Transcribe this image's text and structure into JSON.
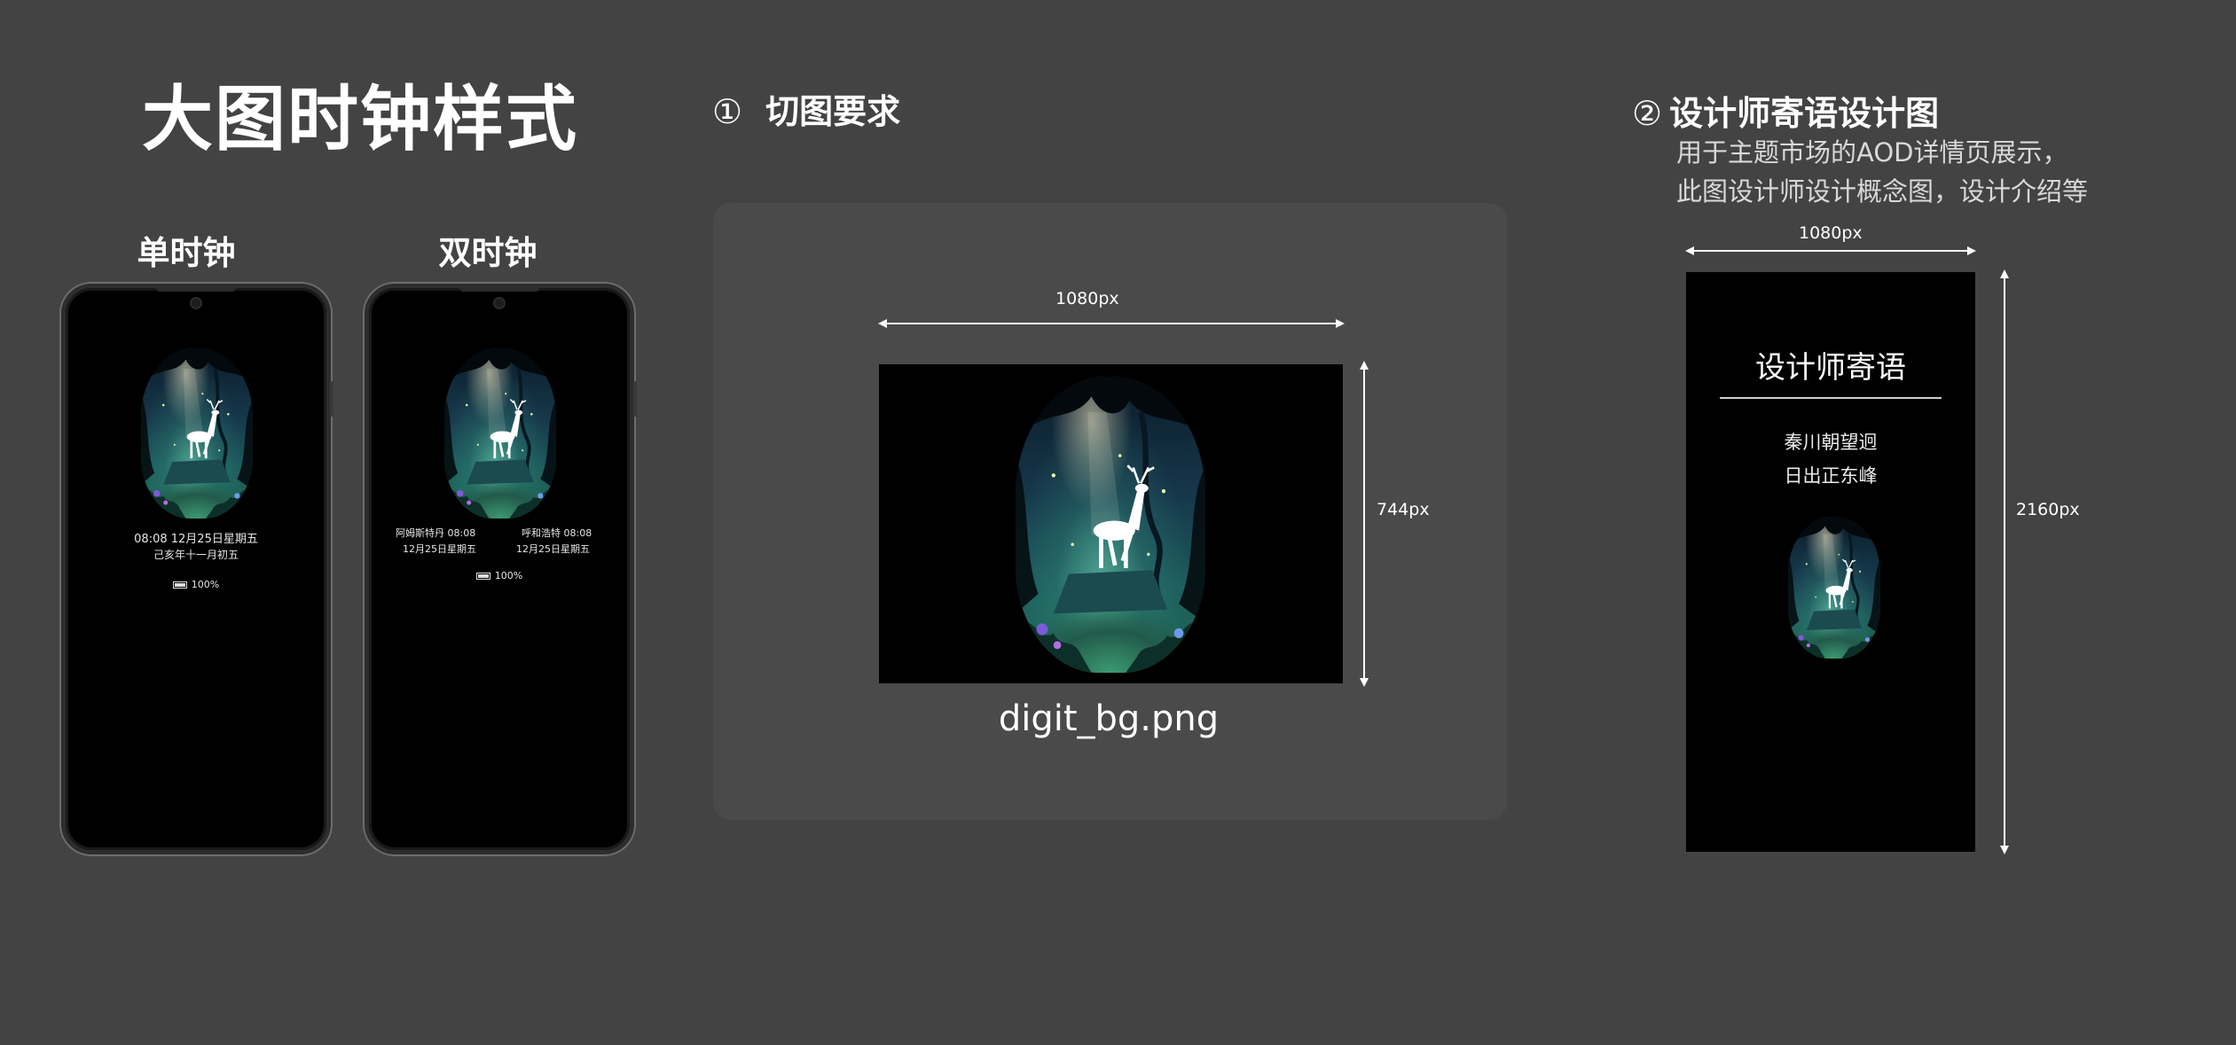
{
  "title": "大图时钟样式",
  "phones": {
    "single_label": "单时钟",
    "dual_label": "双时钟",
    "single": {
      "time_date": "08:08 12月25日星期五",
      "lunar": "己亥年十一月初五",
      "battery": "100%"
    },
    "dual": {
      "left_city_time": "阿姆斯特丹 08:08",
      "left_date": "12月25日星期五",
      "right_city_time": "呼和浩特 08:08",
      "right_date": "12月25日星期五",
      "battery": "100%"
    }
  },
  "section1": {
    "number": "①",
    "title": "切图要求",
    "width_label": "1080px",
    "height_label": "744px",
    "filename": "digit_bg.png"
  },
  "section2": {
    "number": "②",
    "title": "设计师寄语设计图",
    "desc_line1": "用于主题市场的AOD详情页展示，",
    "desc_line2": "此图设计师设计概念图，设计介绍等",
    "width_label": "1080px",
    "height_label": "2160px",
    "preview": {
      "heading": "设计师寄语",
      "poem_line1": "秦川朝望迥",
      "poem_line2": "日出正东峰"
    }
  }
}
